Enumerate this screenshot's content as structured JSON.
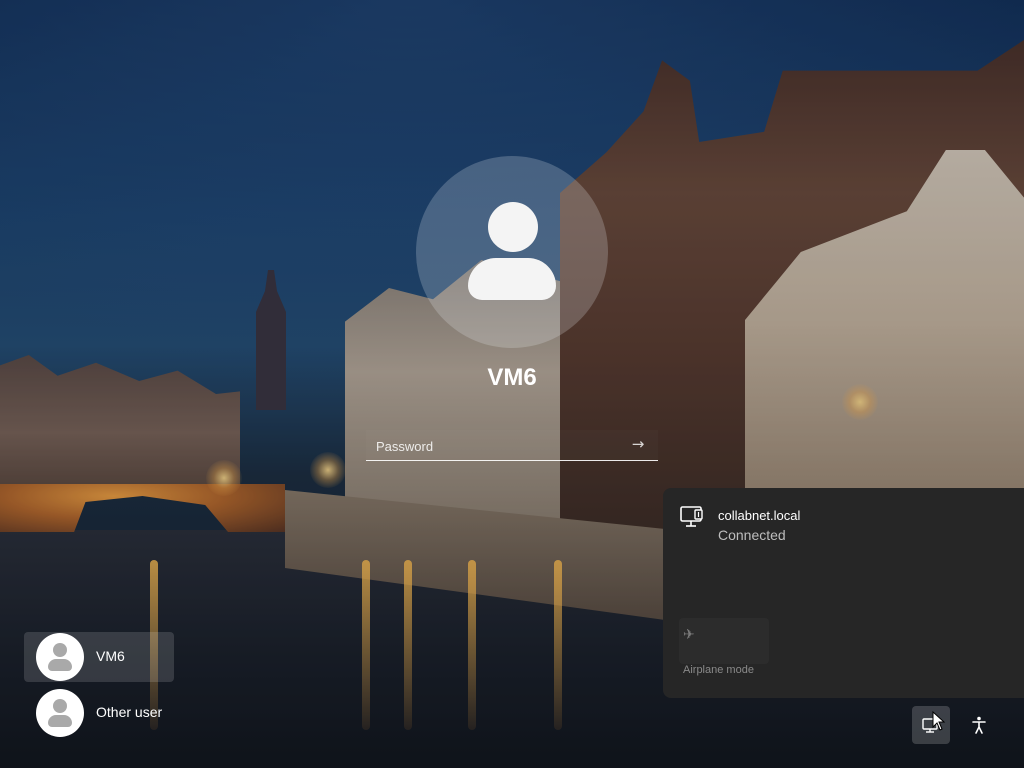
{
  "login": {
    "username": "VM6",
    "password_placeholder": "Password",
    "submit_glyph": "→"
  },
  "users": [
    {
      "name": "VM6",
      "selected": true
    },
    {
      "name": "Other user",
      "selected": false
    }
  ],
  "network_flyout": {
    "network_name": "collabnet.local",
    "status": "Connected",
    "network_icon": "wired-network-icon",
    "airplane_mode_label": "Airplane mode",
    "airplane_icon": "airplane-icon"
  },
  "corner_controls": {
    "network_button_icon": "network-icon",
    "accessibility_button_icon": "accessibility-icon"
  },
  "colors": {
    "flyout_bg": "#262626",
    "text_primary": "#ffffff",
    "text_secondary": "#bdbdbd",
    "text_disabled": "#8a8a8a"
  }
}
